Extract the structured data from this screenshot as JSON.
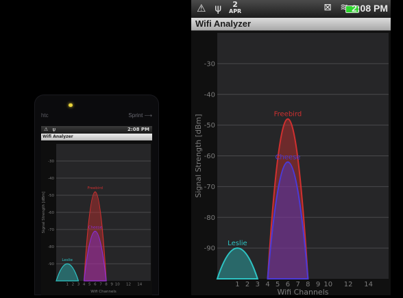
{
  "small_phone": {
    "brand_left": "htc",
    "brand_right": "Sprint ⟶",
    "status_time": "2:08 PM",
    "title": "Wifi Analyzer"
  },
  "statusbar": {
    "left_icons": "⚠ ψ",
    "date_day": "2",
    "date_month": "APR",
    "right_icons": "⊠ ≋",
    "time": "2:08 PM",
    "battery_color": "#2ed52e"
  },
  "app": {
    "title": "Wifi Analyzer"
  },
  "chart_data": {
    "type": "area",
    "ylabel": "Signal Strength [dBm]",
    "xlabel": "Wifi Channels",
    "yticks": [
      -30,
      -40,
      -50,
      -60,
      -70,
      -80,
      -90
    ],
    "ylim": [
      -100,
      -20
    ],
    "xticks": [
      1,
      2,
      3,
      4,
      5,
      6,
      7,
      8,
      9,
      10,
      12,
      14
    ],
    "xlim": [
      -1,
      16
    ],
    "grid": true,
    "series": [
      {
        "name": "Leslie",
        "channel": 1,
        "strength": -90,
        "color": "#2ec4c4"
      },
      {
        "name": "Freebird",
        "channel": 6,
        "strength": -48,
        "color": "#d03030"
      },
      {
        "name": "Cheese",
        "channel": 6,
        "strength": -62,
        "color": "#4a3ad8"
      }
    ]
  },
  "small_chart_data": {
    "type": "area",
    "ylabel": "Signal Strength [dBm]",
    "xlabel": "Wifi Channels",
    "yticks": [
      -30,
      -40,
      -50,
      -60,
      -70,
      -80,
      -90
    ],
    "ylim": [
      -100,
      -20
    ],
    "xticks": [
      1,
      2,
      3,
      4,
      5,
      6,
      7,
      8,
      9,
      10,
      12,
      14
    ],
    "xlim": [
      -1,
      16
    ],
    "series": [
      {
        "name": "Leslie",
        "channel": 1,
        "strength": -90,
        "color": "#2ec4c4"
      },
      {
        "name": "Freebird",
        "channel": 6,
        "strength": -48,
        "color": "#d03030"
      },
      {
        "name": "Cheese",
        "channel": 6,
        "strength": -71,
        "color": "#8a2fd8"
      }
    ]
  }
}
